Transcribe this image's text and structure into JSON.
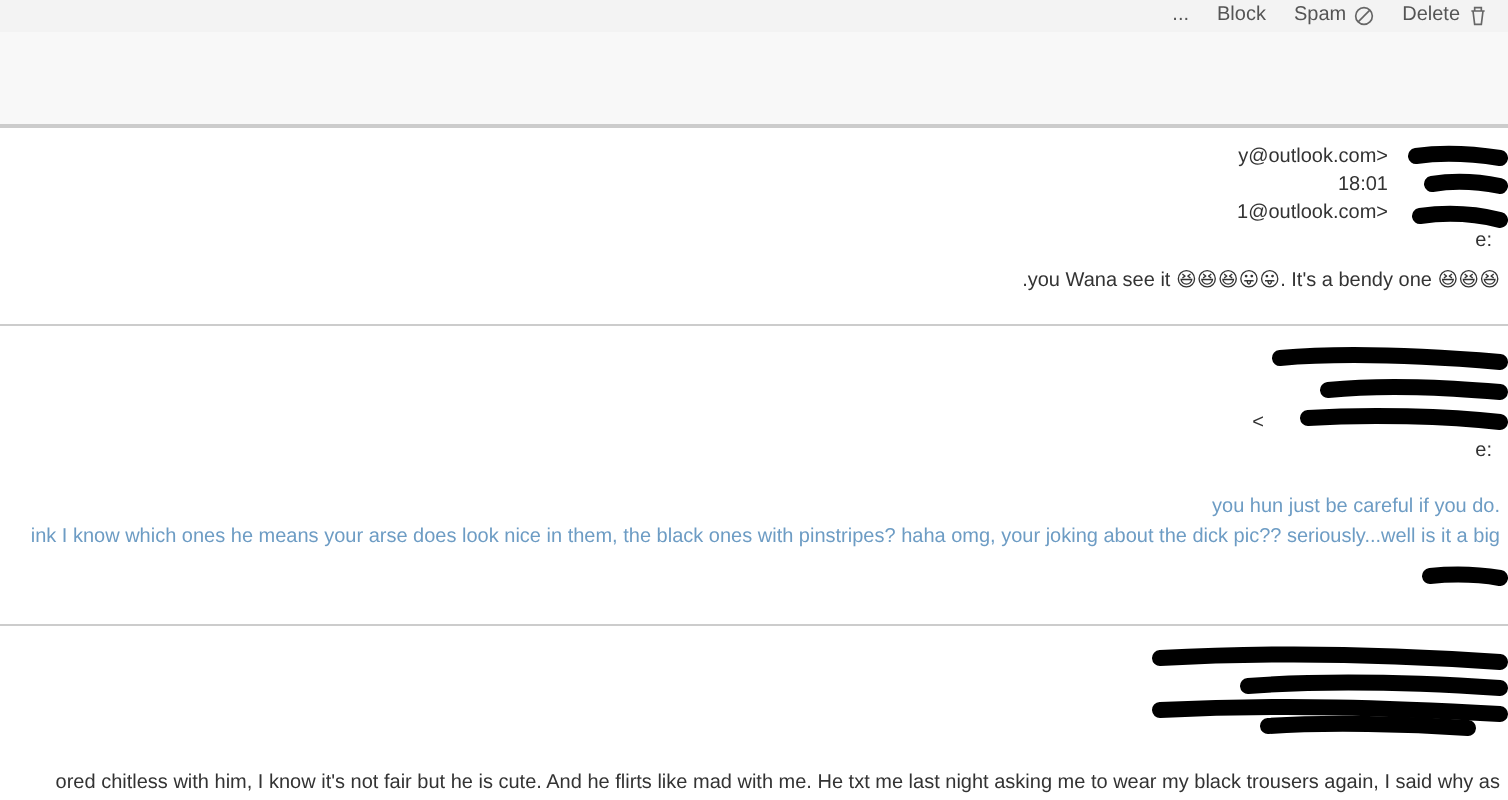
{
  "toolbar": {
    "actions": [
      {
        "kind": "more",
        "label": "..."
      },
      {
        "kind": "block",
        "label": "Block"
      },
      {
        "kind": "spam",
        "label": "Spam"
      },
      {
        "kind": "delete",
        "label": "Delete"
      }
    ]
  },
  "messages": [
    {
      "header": [
        "y@outlook.com>",
        "18:01",
        "1@outlook.com>",
        "e:"
      ],
      "paragraphs": [
        {
          "kind": "plain",
          "text": ".you Wana see it 😆😆😆😛😛. It's a bendy one 😆😆😆"
        }
      ]
    },
    {
      "header": [
        "<",
        "e:"
      ],
      "paragraphs": [
        {
          "kind": "quoted",
          "text": "you hun just be careful if you do."
        },
        {
          "kind": "quoted",
          "text": "ink I know which ones he means your arse does look nice in them, the black ones with pinstripes? haha omg, your joking about the dick pic?? seriously...well is it a big"
        }
      ]
    },
    {
      "paragraphs": [
        {
          "kind": "plain",
          "text": "ored chitless with him, I know it's not fair but he is cute. And he flirts like mad with me. He txt me last night asking me to wear my black trousers again, I said why as"
        }
      ]
    }
  ]
}
